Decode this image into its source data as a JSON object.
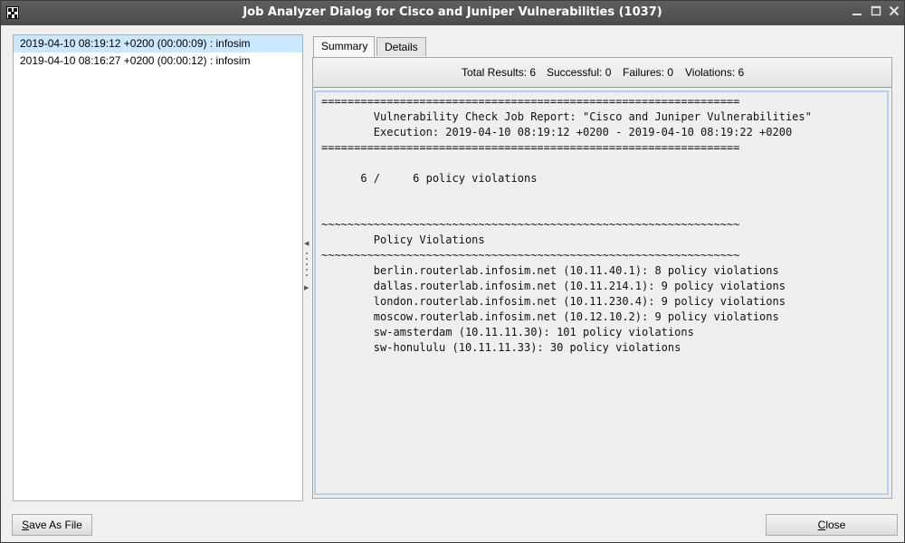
{
  "window": {
    "title": "Job Analyzer Dialog for Cisco and Juniper Vulnerabilities (1037)"
  },
  "runs": [
    "2019-04-10 08:19:12 +0200 (00:00:09) : infosim",
    "2019-04-10 08:16:27 +0200 (00:00:12) : infosim"
  ],
  "tabs": {
    "summary": "Summary",
    "details": "Details"
  },
  "stats": {
    "total": "Total Results: 6",
    "successful": "Successful: 0",
    "failures": "Failures: 0",
    "violations": "Violations: 6"
  },
  "report": {
    "rule_eq": "================================================================",
    "title": "        Vulnerability Check Job Report: \"Cisco and Juniper Vulnerabilities\"",
    "execution": "        Execution: 2019-04-10 08:19:12 +0200 - 2019-04-10 08:19:22 +0200",
    "count": "      6 /     6 policy violations",
    "rule_tilde": "~~~~~~~~~~~~~~~~~~~~~~~~~~~~~~~~~~~~~~~~~~~~~~~~~~~~~~~~~~~~~~~~",
    "section": "        Policy Violations",
    "devices": [
      "        berlin.routerlab.infosim.net (10.11.40.1): 8 policy violations",
      "        dallas.routerlab.infosim.net (10.11.214.1): 9 policy violations",
      "        london.routerlab.infosim.net (10.11.230.4): 9 policy violations",
      "        moscow.routerlab.infosim.net (10.12.10.2): 9 policy violations",
      "        sw-amsterdam (10.11.11.30): 101 policy violations",
      "        sw-honululu (10.11.11.33): 30 policy violations"
    ]
  },
  "buttons": {
    "save_first": "S",
    "save_rest": "ave As File",
    "close_first": "C",
    "close_rest": "lose"
  },
  "icons": {
    "minimize": "minimize-icon",
    "maximize": "maximize-icon",
    "close": "close-icon"
  }
}
